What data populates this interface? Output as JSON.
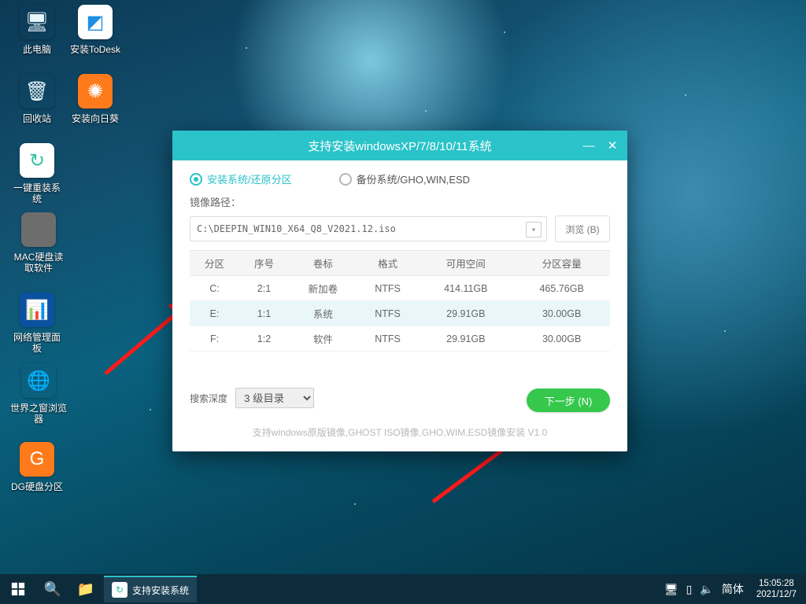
{
  "desktop_icons": [
    {
      "label": "此电脑",
      "id": "this-pc",
      "glyph": "🖥",
      "bg": "transparent",
      "fg": "#e8f6fb"
    },
    {
      "label": "安装ToDesk",
      "id": "todesk",
      "glyph": "◩",
      "bg": "#ffffff",
      "fg": "#1e8fe6"
    },
    {
      "label": "回收站",
      "id": "recycle-bin",
      "glyph": "🗑",
      "bg": "transparent",
      "fg": "#e8f6fb"
    },
    {
      "label": "安装向日葵",
      "id": "sunlogin",
      "glyph": "✺",
      "bg": "#ff7a1a",
      "fg": "#ffffff"
    },
    {
      "label": "一键重装系统",
      "id": "reinstall",
      "glyph": "↻",
      "bg": "#ffffff",
      "fg": "#34bfa3"
    },
    {
      "label": "MAC硬盘读取软件",
      "id": "mac-disk",
      "glyph": "",
      "bg": "#6d6d6d",
      "fg": "#ffffff"
    },
    {
      "label": "网络管理面板",
      "id": "net-panel",
      "glyph": "📊",
      "bg": "#0a52a0",
      "fg": "#ffffff"
    },
    {
      "label": "世界之窗浏览器",
      "id": "theworld-browser",
      "glyph": "🌐",
      "bg": "transparent",
      "fg": "#e8f6fb"
    },
    {
      "label": "DG硬盘分区",
      "id": "diskgenius",
      "glyph": "G",
      "bg": "#ff7a1a",
      "fg": "#ffffff"
    }
  ],
  "installer": {
    "title": "支持安装windowsXP/7/8/10/11系统",
    "mode_install": "安装系统/还原分区",
    "mode_backup": "备份系统/GHO,WIN,ESD",
    "pathlabel": "镜像路径：",
    "path": "C:\\DEEPIN_WIN10_X64_Q8_V2021.12.iso",
    "browse": "浏览 (B)",
    "headers": [
      "分区",
      "序号",
      "卷标",
      "格式",
      "可用空间",
      "分区容量"
    ],
    "rows": [
      {
        "drive": "C:",
        "idx": "2:1",
        "label": "新加卷",
        "fs": "NTFS",
        "free": "414.11GB",
        "cap": "465.76GB",
        "sel": false
      },
      {
        "drive": "E:",
        "idx": "1:1",
        "label": "系统",
        "fs": "NTFS",
        "free": "29.91GB",
        "cap": "30.00GB",
        "sel": true
      },
      {
        "drive": "F:",
        "idx": "1:2",
        "label": "软件",
        "fs": "NTFS",
        "free": "29.91GB",
        "cap": "30.00GB",
        "sel": false
      }
    ],
    "depthlabel": "搜索深度",
    "depthvalue": "3 级目录",
    "next": "下一步 (N)",
    "hint": "支持windows原版镜像,GHOST ISO镜像,GHO,WIM,ESD镜像安装   V1.0"
  },
  "taskbar": {
    "app": "支持安装系统",
    "ime": "简体",
    "time": "15:05:28",
    "date": "2021/12/7"
  }
}
